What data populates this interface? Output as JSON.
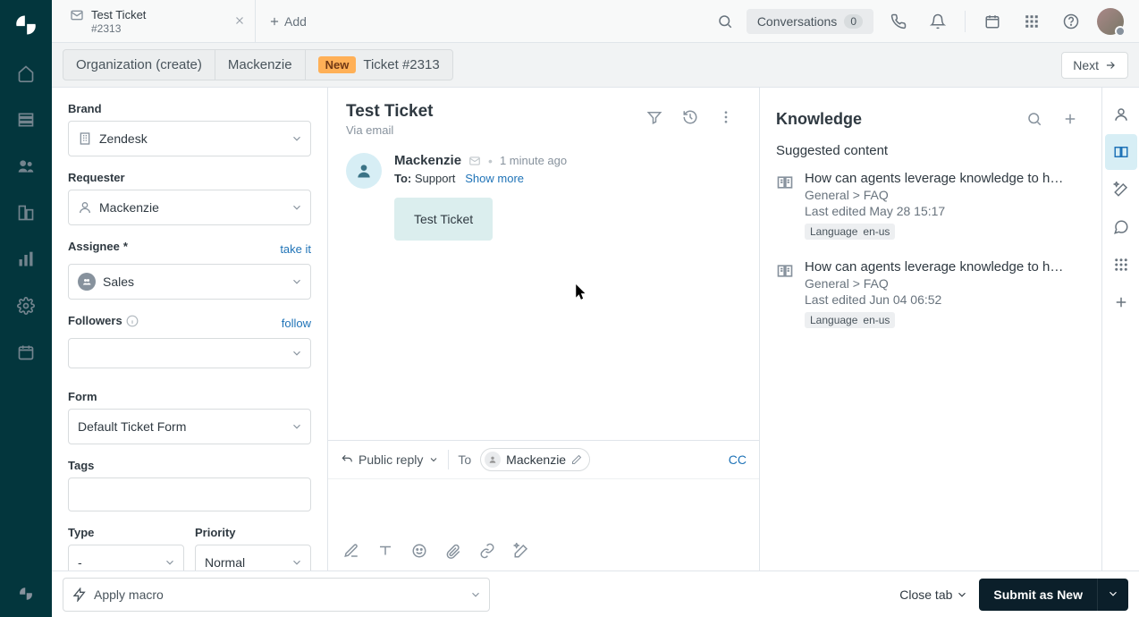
{
  "topbar": {
    "tab_title": "Test Ticket",
    "tab_sub": "#2313",
    "add_label": "Add",
    "conversations_label": "Conversations",
    "conversations_count": "0"
  },
  "crumbs": {
    "org": "Organization (create)",
    "user": "Mackenzie",
    "badge": "New",
    "ticket": "Ticket #2313",
    "next": "Next"
  },
  "sidebar": {
    "brand_label": "Brand",
    "brand_value": "Zendesk",
    "requester_label": "Requester",
    "requester_value": "Mackenzie",
    "assignee_label": "Assignee",
    "assignee_value": "Sales",
    "take_it": "take it",
    "followers_label": "Followers",
    "follow": "follow",
    "form_label": "Form",
    "form_value": "Default Ticket Form",
    "tags_label": "Tags",
    "type_label": "Type",
    "type_value": "-",
    "priority_label": "Priority",
    "priority_value": "Normal"
  },
  "center": {
    "title": "Test Ticket",
    "via": "Via email",
    "msg_name": "Mackenzie",
    "msg_time": "1 minute ago",
    "to_label": "To:",
    "to_value": "Support",
    "show_more": "Show more",
    "body": "Test Ticket"
  },
  "composer": {
    "reply_mode": "Public reply",
    "to_label": "To",
    "recipient": "Mackenzie",
    "cc": "CC"
  },
  "knowledge": {
    "title": "Knowledge",
    "sub": "Suggested content",
    "items": [
      {
        "title": "How can agents leverage knowledge to help …",
        "path": "General > FAQ",
        "edited": "Last edited May 28 15:17",
        "lang_label": "Language",
        "lang_value": "en-us"
      },
      {
        "title": "How can agents leverage knowledge to help …",
        "path": "General > FAQ",
        "edited": "Last edited Jun 04 06:52",
        "lang_label": "Language",
        "lang_value": "en-us"
      }
    ]
  },
  "footer": {
    "macro": "Apply macro",
    "close_tab": "Close tab",
    "submit": "Submit as New"
  }
}
